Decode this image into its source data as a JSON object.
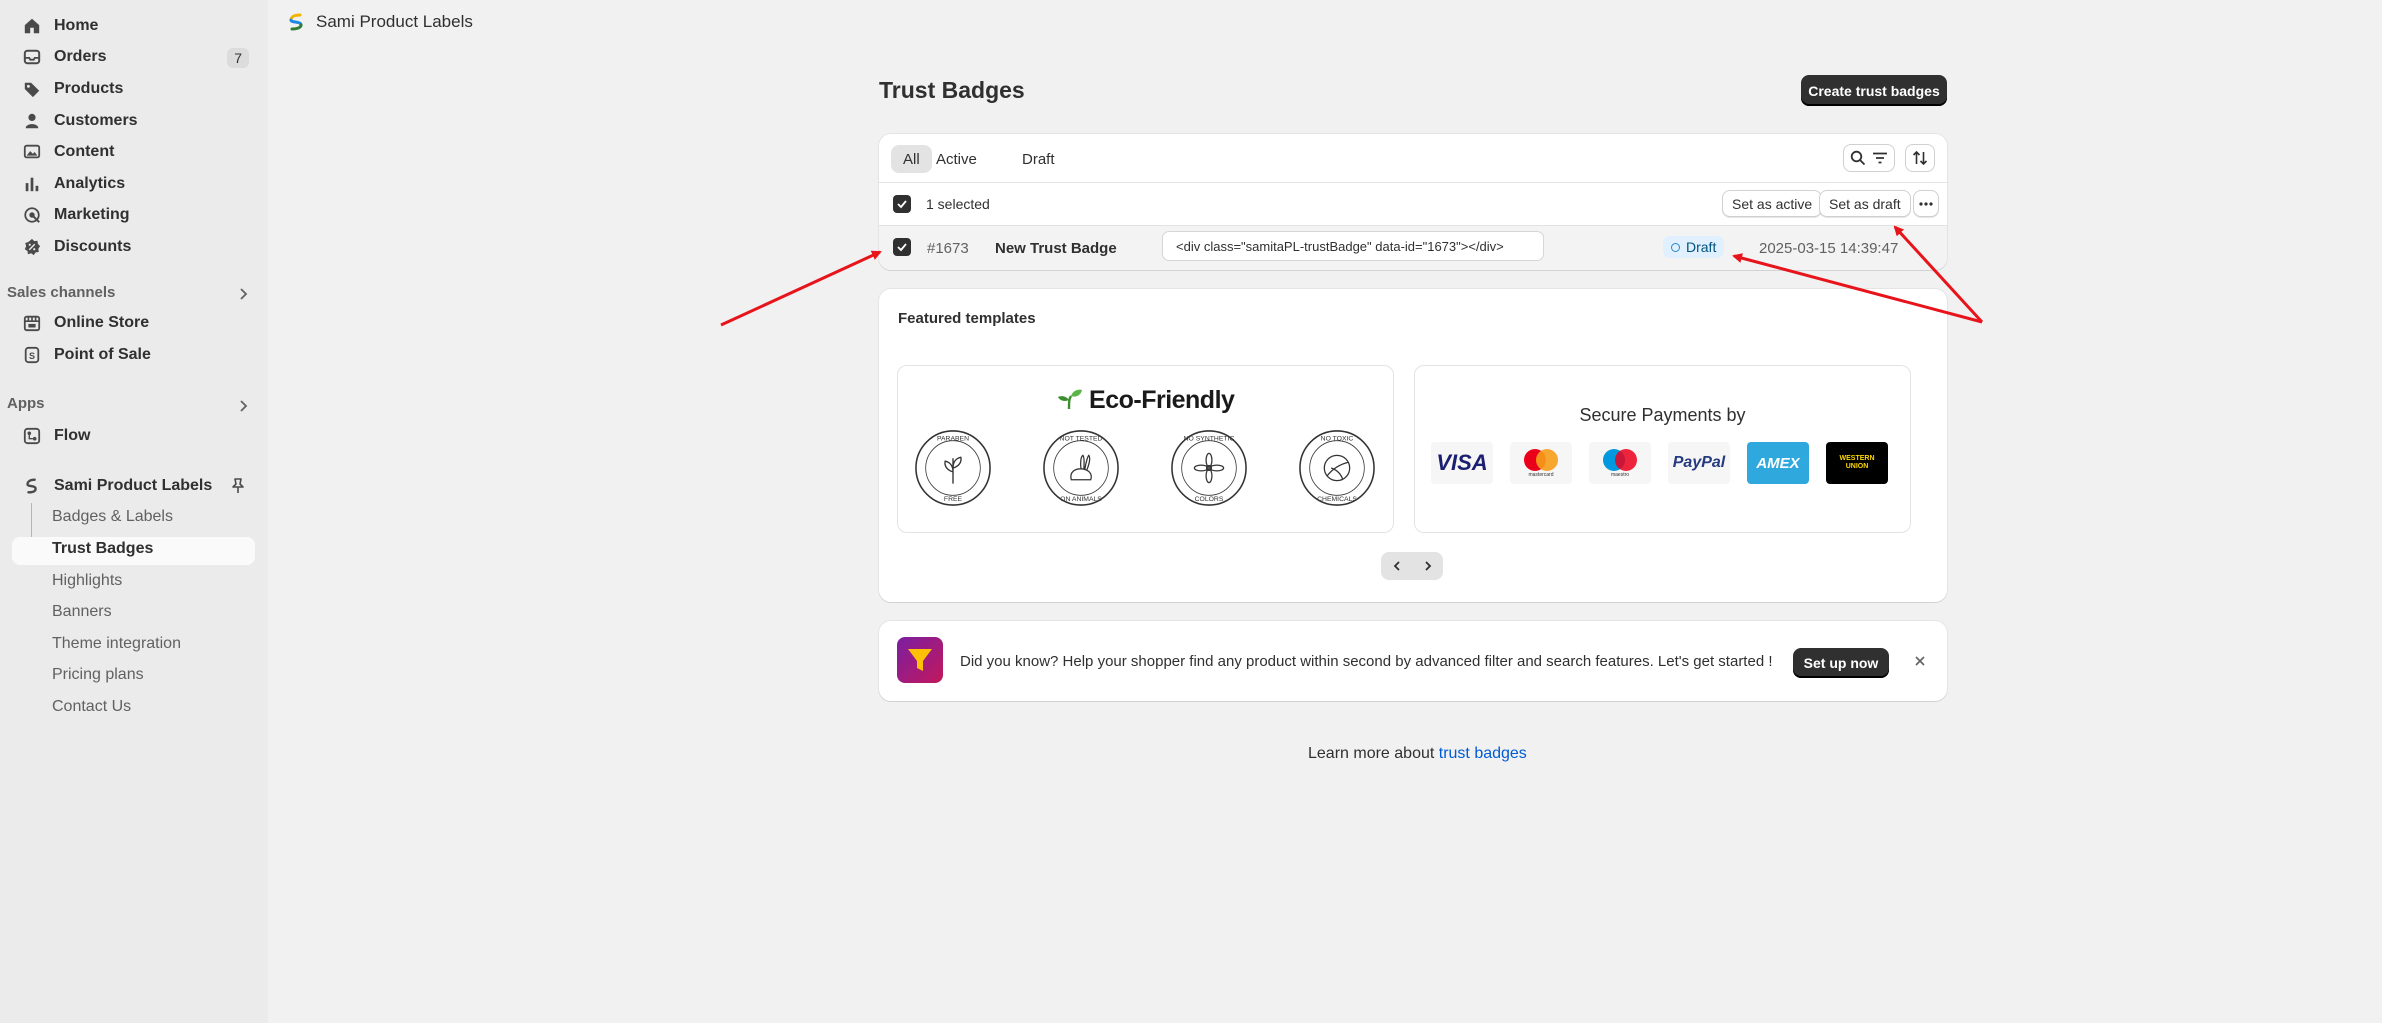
{
  "sidebar": {
    "items": [
      {
        "label": "Home",
        "icon": "home-icon"
      },
      {
        "label": "Orders",
        "icon": "inbox-icon",
        "badge": "7"
      },
      {
        "label": "Products",
        "icon": "tag-icon"
      },
      {
        "label": "Customers",
        "icon": "person-icon"
      },
      {
        "label": "Content",
        "icon": "image-icon"
      },
      {
        "label": "Analytics",
        "icon": "bar-chart-icon"
      },
      {
        "label": "Marketing",
        "icon": "target-icon"
      },
      {
        "label": "Discounts",
        "icon": "discount-icon"
      }
    ],
    "sales_channels_label": "Sales channels",
    "sales_channels": [
      {
        "label": "Online Store",
        "icon": "store-icon"
      },
      {
        "label": "Point of Sale",
        "icon": "pos-icon"
      }
    ],
    "apps_label": "Apps",
    "apps": [
      {
        "label": "Flow",
        "icon": "flow-icon"
      },
      {
        "label": "Sami Product Labels",
        "icon": "app-logo-icon"
      }
    ],
    "app_subitems": [
      "Badges & Labels",
      "Trust Badges",
      "Highlights",
      "Banners",
      "Theme integration",
      "Pricing plans",
      "Contact Us"
    ]
  },
  "header": {
    "app_title": "Sami Product Labels"
  },
  "page": {
    "title": "Trust Badges",
    "create_button": "Create trust badges"
  },
  "list": {
    "tabs": [
      "All",
      "Active",
      "Draft"
    ],
    "selected_text": "1 selected",
    "set_active": "Set as active",
    "set_draft": "Set as draft",
    "row": {
      "id": "#1673",
      "name": "New Trust Badge",
      "code": "<div class=\"samitaPL-trustBadge\" data-id=\"1673\"></div>",
      "status": "Draft",
      "date": "2025-03-15 14:39:47"
    }
  },
  "templates": {
    "title": "Featured templates",
    "eco_title": "Eco-Friendly",
    "eco_badges": [
      {
        "top": "PARABEN",
        "bottom": "FREE"
      },
      {
        "top": "NOT TESTED",
        "bottom": "ON ANIMALS"
      },
      {
        "top": "NO SYNTHETIC",
        "bottom": "COLORS"
      },
      {
        "top": "NO TOXIC",
        "bottom": "CHEMICALS"
      }
    ],
    "payments_title": "Secure Payments by",
    "payments": [
      "VISA",
      "mastercard",
      "maestro",
      "PayPal",
      "AMEX",
      "WESTERN UNION"
    ]
  },
  "promo": {
    "text": "Did you know? Help your shopper find any product within second by advanced filter and search features. Let's get started !",
    "button": "Set up now"
  },
  "footer": {
    "text": "Learn more about ",
    "link": "trust badges"
  },
  "colors": {
    "primary": "#303030",
    "link": "#005bd3",
    "annotation": "#e8141b",
    "status_draft_bg": "#e0f0ff"
  }
}
